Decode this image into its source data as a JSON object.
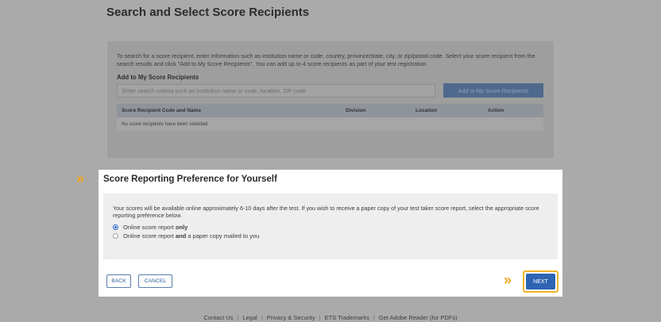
{
  "page_title": "Search and Select Score Recipients",
  "search_panel": {
    "instructions": "To search for a score recipient, enter information such as institution name or code, country, province/state, city, or zip/postal code. Select your score recipient from the search results and click \"Add to My Score Recipients\". You can add up to 4 score recipients as part of your test registration.",
    "subtitle": "Add to My Score Recipients",
    "search_placeholder": "Enter search criteria such as institution name or code, location, ZIP code",
    "add_button": "Add to My Score Recipients",
    "table": {
      "columns": [
        "Score Recipient Code and Name",
        "Division",
        "Location",
        "Action"
      ],
      "empty_message": "No score recipients have been selected"
    }
  },
  "modal": {
    "title": "Score Reporting Preference for Yourself",
    "description": "Your scores will be available online approximately 6-10 days after the test. If you wish to receive a paper copy of your test taker score report, select the appropriate score reporting preference below.",
    "options": [
      {
        "prefix": "Online score report ",
        "bold": "only",
        "suffix": "",
        "checked": true
      },
      {
        "prefix": "Online score report ",
        "bold": "and",
        "suffix": " a paper copy mailed to you",
        "checked": false
      }
    ],
    "back_label": "BACK",
    "cancel_label": "CANCEL",
    "next_label": "NEXT"
  },
  "chevron_glyph": "»",
  "footer": {
    "links": [
      "Contact Us",
      "Legal",
      "Privacy & Security",
      "ETS Trademarks",
      "Get Adobe Reader (for PDFs)"
    ],
    "separator": "|"
  },
  "colors": {
    "accent": "#f3a81d",
    "primary": "#2d64b4"
  }
}
